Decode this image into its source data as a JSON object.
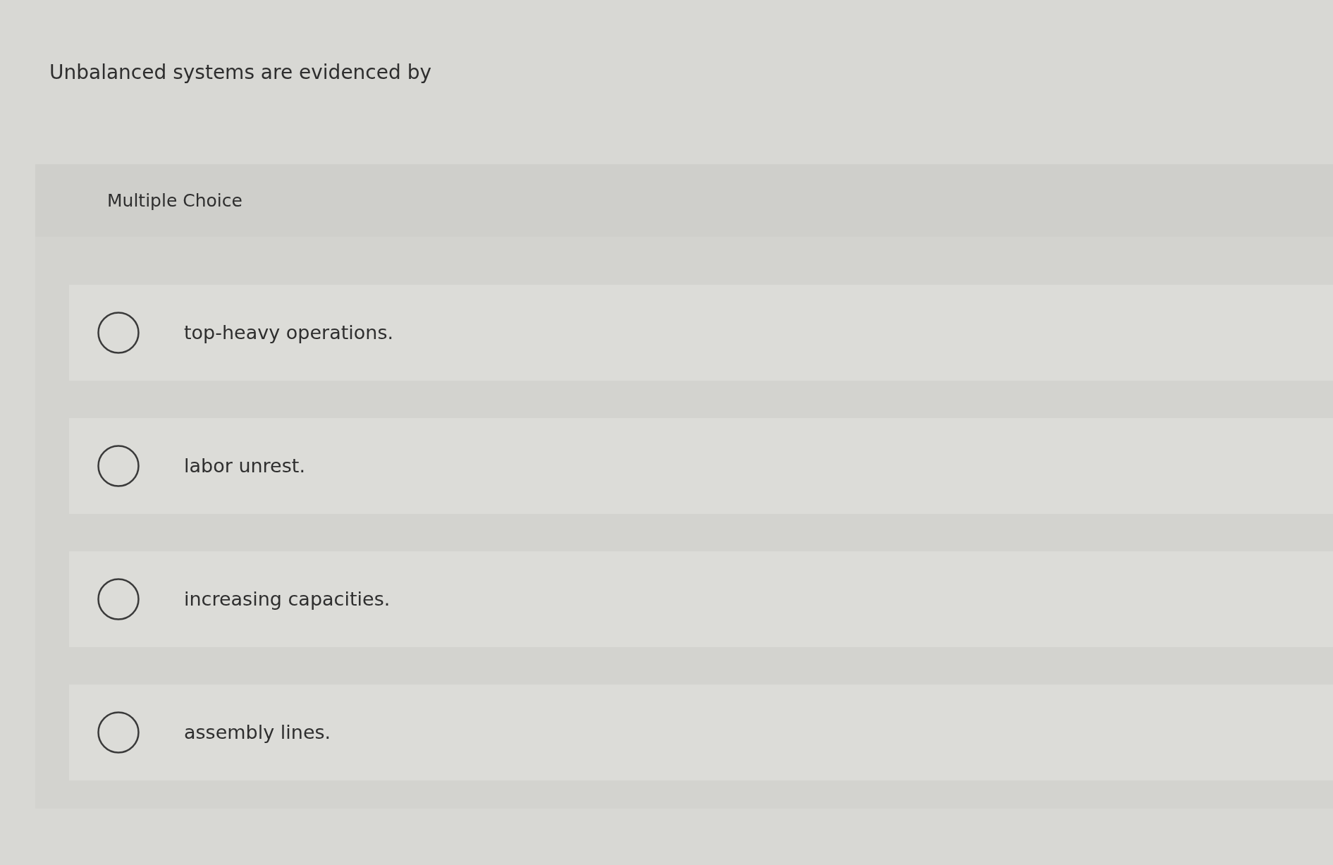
{
  "question": "Unbalanced systems are evidenced by",
  "answer_panel": {
    "heading": "Multiple Choice",
    "options": [
      {
        "text": "top-heavy operations.",
        "selected": false
      },
      {
        "text": "labor unrest.",
        "selected": false
      },
      {
        "text": "increasing capacities.",
        "selected": false
      },
      {
        "text": "assembly lines.",
        "selected": false
      }
    ]
  }
}
